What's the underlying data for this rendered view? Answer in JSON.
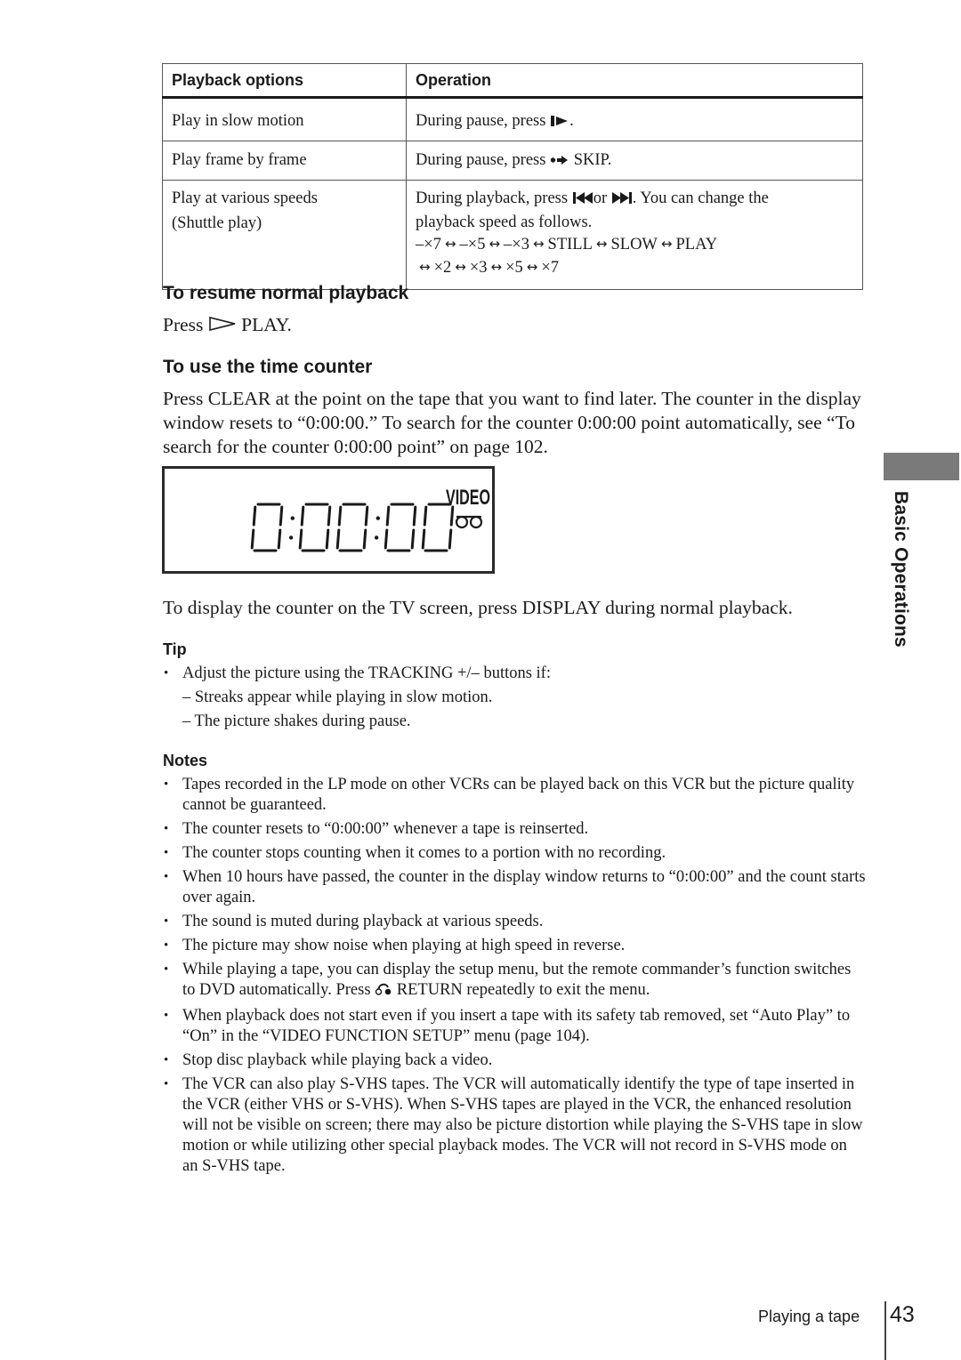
{
  "table": {
    "headers": [
      "Playback options",
      "Operation"
    ],
    "rows": [
      {
        "option": "Play in slow motion",
        "operation_before": "During pause, press",
        "operation_icon": "slow-play-icon",
        "operation_after": "."
      },
      {
        "option": "Play frame by frame",
        "operation_before": "During pause, press",
        "operation_icon": "skip-icon",
        "operation_after": "SKIP."
      },
      {
        "option_line1": "Play at various speeds",
        "option_line2": "(Shuttle play)",
        "operation_before": "During playback, press",
        "operation_icon1": "previous-icon",
        "operation_or": "or",
        "operation_icon2": "next-icon",
        "operation_after": ".  You can change the",
        "operation_line2": "playback speed as follows.",
        "speeds_line1": [
          "–×7",
          "–×5",
          "–×3",
          "STILL",
          "SLOW",
          "PLAY"
        ],
        "speeds_line2": [
          "×2",
          "×3",
          "×5",
          "×7"
        ],
        "arrow_symbol": "↔"
      }
    ]
  },
  "resume": {
    "heading": "To resume normal playback",
    "text_before": "Press",
    "icon": "play-icon",
    "text_after": "PLAY."
  },
  "counter": {
    "heading": "To use the time counter",
    "paragraph": "Press CLEAR at the point on the tape that you want to find later.  The counter in the display window resets to “0:00:00.”  To search for the counter 0:00:00 point automatically, see “To search for the counter 0:00:00 point” on page 102.",
    "display": {
      "readout": "0:00:00",
      "mode_label": "VIDEO",
      "mode_icon": "tape-icon"
    },
    "tv_paragraph": "To display the counter on the TV screen, press DISPLAY during normal playback."
  },
  "tip": {
    "heading": "Tip",
    "bullet": "Adjust the picture using the TRACKING +/– buttons if:",
    "subitems": [
      "– Streaks appear while playing in slow motion.",
      "– The picture shakes during pause."
    ]
  },
  "notes": {
    "heading": "Notes",
    "items": [
      "Tapes recorded in the LP mode on other VCRs can be played back on this VCR but the picture quality cannot be guaranteed.",
      "The counter resets to “0:00:00” whenever a tape is reinserted.",
      "The counter stops counting when it comes to a portion with no recording.",
      "When 10 hours have passed, the counter in the display window returns to “0:00:00” and the count starts over again.",
      "The sound is muted during playback at various speeds.",
      "The picture may show noise when playing at high speed in reverse.",
      "While playing a tape, you can display the setup menu, but the remote commander’s function switches to DVD automatically.  Press",
      "When playback does not start even if you insert a tape with its safety tab removed, set “Auto Play” to “On” in the “VIDEO FUNCTION SETUP” menu (page 104).",
      "Stop disc playback while playing back a video.",
      "The VCR can also play S-VHS tapes.  The VCR will automatically identify the type of tape inserted in the VCR (either VHS or S-VHS).  When S-VHS tapes are played in the VCR, the enhanced resolution will not be visible on screen; there may also be picture distortion while playing the S-VHS tape in slow motion or while utilizing other special playback modes.  The VCR will not record in S-VHS mode on an S-VHS tape."
    ],
    "return_icon": "return-icon",
    "return_tail": "RETURN repeatedly to exit the menu.",
    "bullet_char": "•"
  },
  "side_tab": {
    "label": "Basic Operations",
    "color": "#7a7a7a"
  },
  "footer": {
    "section": "Playing a tape",
    "page_number": "43"
  }
}
